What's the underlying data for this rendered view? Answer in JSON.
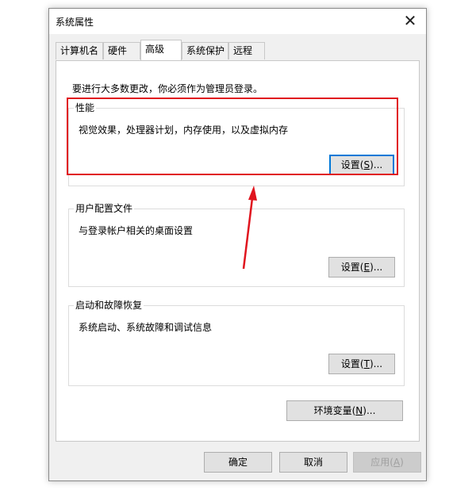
{
  "window": {
    "title": "系统属性",
    "close_glyph": "✕"
  },
  "tabs": [
    {
      "label": "计算机名",
      "active": false
    },
    {
      "label": "硬件",
      "active": false
    },
    {
      "label": "高级",
      "active": true
    },
    {
      "label": "系统保护",
      "active": false
    },
    {
      "label": "远程",
      "active": false
    }
  ],
  "admin_note": "要进行大多数更改，你必须作为管理员登录。",
  "performance": {
    "title": "性能",
    "desc": "视觉效果，处理器计划，内存使用，以及虚拟内存",
    "button_text": "设置",
    "button_hotkey": "S",
    "button_suffix": "..."
  },
  "user_profiles": {
    "title": "用户配置文件",
    "desc": "与登录帐户相关的桌面设置",
    "button_text": "设置",
    "button_hotkey": "E",
    "button_suffix": "..."
  },
  "startup_recovery": {
    "title": "启动和故障恢复",
    "desc": "系统启动、系统故障和调试信息",
    "button_text": "设置",
    "button_hotkey": "T",
    "button_suffix": "..."
  },
  "env_vars": {
    "button_text": "环境变量",
    "button_hotkey": "N",
    "button_suffix": "..."
  },
  "footer": {
    "ok": "确定",
    "cancel": "取消",
    "apply_text": "应用",
    "apply_hotkey": "A"
  },
  "annotation": {
    "highlight_color": "#e0141e"
  }
}
